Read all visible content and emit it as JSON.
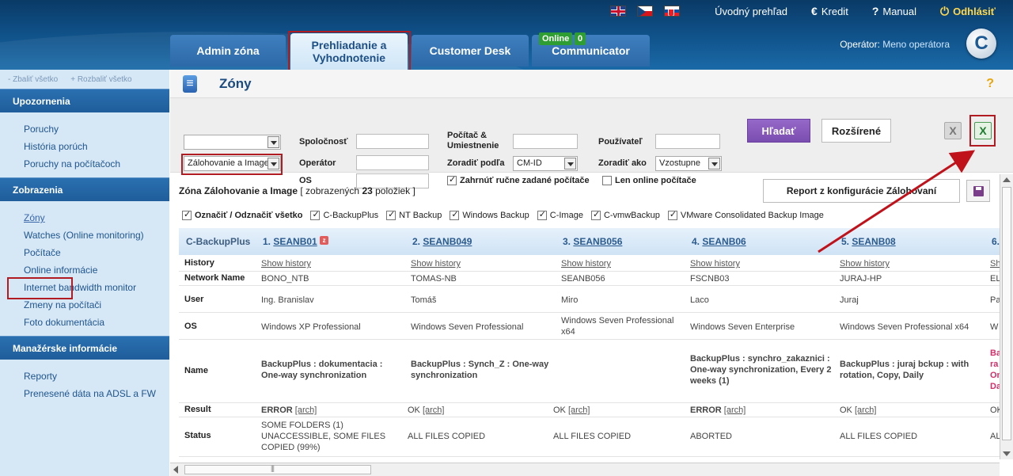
{
  "topbar": {
    "languages": [
      "English",
      "Czech",
      "Slovak"
    ],
    "links": [
      {
        "label": "Úvodný prehľad",
        "icon": ""
      },
      {
        "label": "Kredit",
        "icon": "euro-icon"
      },
      {
        "label": "Manual",
        "icon": "question-icon"
      },
      {
        "label": "Odhlásiť",
        "icon": "power-icon"
      }
    ],
    "logout_color": "#ffd84d"
  },
  "tabs": [
    {
      "label": "Admin zóna"
    },
    {
      "label": "Prehliadanie a Vyhodnotenie"
    },
    {
      "label": "Customer Desk"
    },
    {
      "label": "Communicator"
    }
  ],
  "badges": {
    "online": "Online",
    "count": "0"
  },
  "operator": {
    "label": "Operátor:",
    "name": "Meno operátora"
  },
  "logo_letter": "C",
  "sidebar": {
    "collapse_all": "- Zbaliť všetko",
    "expand_all": "+ Rozbaliť všetko",
    "sections": [
      {
        "title": "Upozornenia",
        "items": [
          "Poruchy",
          "História porúch",
          "Poruchy na počítačoch"
        ]
      },
      {
        "title": "Zobrazenia",
        "items": [
          "Zóny",
          "Watches (Online monitoring)",
          "Počítače",
          "Online informácie",
          "Internet bandwidth monitor",
          "Zmeny na počítači",
          "Foto dokumentácia"
        ]
      },
      {
        "title": "Manažérske informácie",
        "items": [
          "Reporty",
          "Prenesené dáta na ADSL a FW"
        ]
      }
    ]
  },
  "page": {
    "title": "Zóny",
    "help": "?"
  },
  "filters": {
    "select1_value": "",
    "select2_value": "Zálohovanie a Image",
    "company_label": "Spoločnosť",
    "operator_label": "Operátor",
    "os_label": "OS",
    "computer_label": "Počítač &",
    "location_label": "Umiestnenie",
    "sort_by_label": "Zoradiť podľa",
    "sort_by_value": "CM-ID",
    "user_label": "Používateľ",
    "sort_order_label": "Zoradiť ako",
    "sort_order_value": "Vzostupne",
    "include_manual": "Zahrnúť ručne zadané počítače",
    "only_online": "Len online počítače",
    "search_button": "Hľadať",
    "advanced_button": "Rozšírené",
    "xls_gray": "X",
    "xls_green": "X",
    "search_color": "#8a5cc0"
  },
  "list": {
    "zone_prefix": "Zóna Zálohovanie a Image",
    "count_text_pre": "[ zobrazených ",
    "count": "23",
    "count_text_post": " položiek ]",
    "report_button": "Report z konfigurácie Zálohovaní"
  },
  "types": [
    {
      "label": "Označiť / Odznačiť všetko",
      "bold": true
    },
    {
      "label": "C-BackupPlus"
    },
    {
      "label": "NT Backup"
    },
    {
      "label": "Windows Backup"
    },
    {
      "label": "C-Image"
    },
    {
      "label": "C-vmwBackup"
    },
    {
      "label": "VMware Consolidated Backup Image"
    }
  ],
  "table": {
    "group_label": "C-BackupPlus",
    "computers": [
      {
        "num": "1.",
        "name": "SEANB01"
      },
      {
        "num": "2.",
        "name": "SEANB049"
      },
      {
        "num": "3.",
        "name": "SEANB056"
      },
      {
        "num": "4.",
        "name": "SEANB06"
      },
      {
        "num": "5.",
        "name": "SEANB08"
      },
      {
        "num": "6.",
        "name": ""
      }
    ],
    "row_labels": [
      "History",
      "Network Name",
      "User",
      "OS",
      "Name",
      "Result",
      "Status"
    ],
    "history": [
      "Show history",
      "Show history",
      "Show history",
      "Show history",
      "Show history",
      "Sh"
    ],
    "network": [
      "BONO_NTB",
      "TOMAS-NB",
      "SEANB056",
      "FSCNB03",
      "JURAJ-HP",
      "EL"
    ],
    "user": [
      "Ing. Branislav",
      "Tomáš",
      "Miro",
      "Laco",
      "Juraj",
      "Pa"
    ],
    "os": [
      "Windows XP Professional",
      "Windows Seven Professional",
      "Windows Seven Professional x64",
      "Windows Seven Enterprise",
      "Windows Seven Professional x64",
      "W"
    ],
    "name": [
      "BackupPlus : dokumentacia : One-way synchronization",
      "BackupPlus : Synch_Z : One-way synchronization",
      "",
      "BackupPlus : synchro_zakaznici : One-way synchronization, Every 2 weeks (1)",
      "BackupPlus : juraj bckup : with rotation, Copy, Daily",
      "Ba ra On Da"
    ],
    "result": [
      "ERROR",
      "OK",
      "OK",
      "ERROR",
      "OK",
      "OK"
    ],
    "result_link": "[arch]",
    "status": [
      "SOME FOLDERS (1) UNACCESSIBLE, SOME FILES COPIED (99%)",
      "ALL FILES COPIED",
      "ALL FILES COPIED",
      "ABORTED",
      "ALL FILES COPIED",
      "AL"
    ]
  }
}
